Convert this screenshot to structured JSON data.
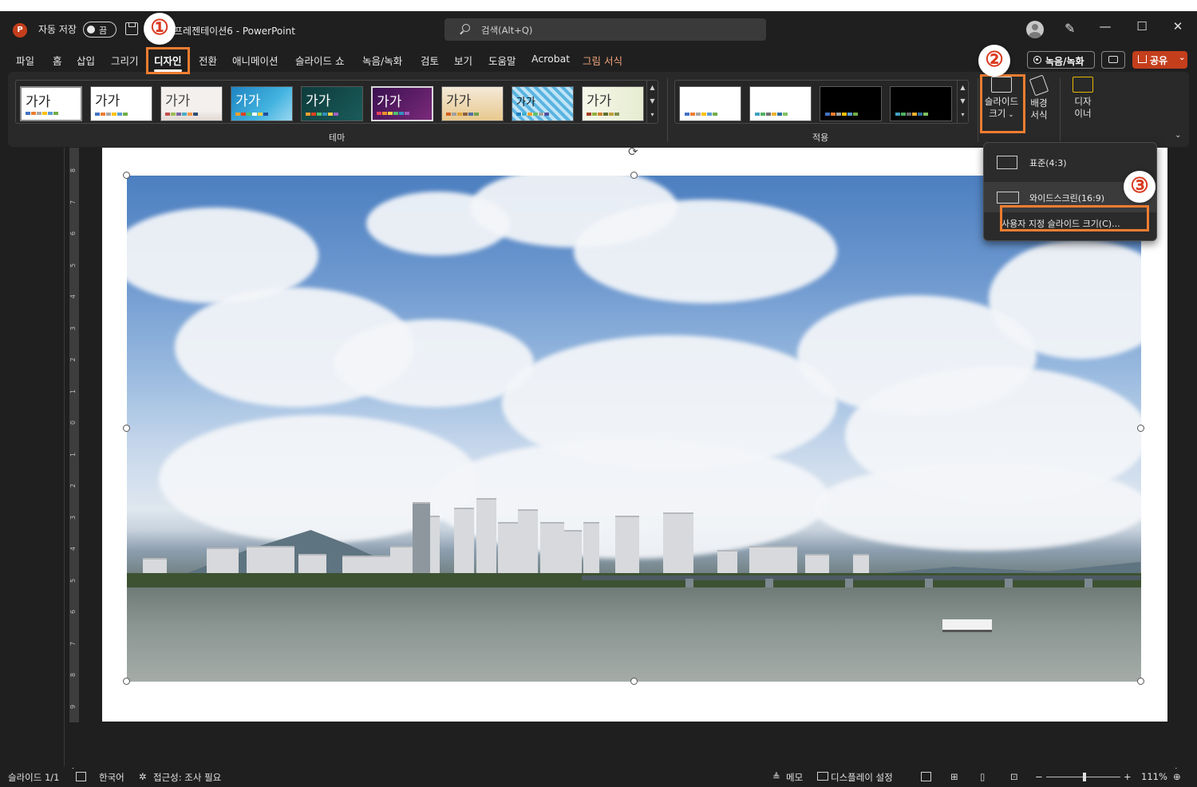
{
  "window": {
    "app_icon": "P",
    "autosave_label": "자동 저장",
    "autosave_state": "끔",
    "doc_title": "프레젠테이션6 - PowerPoint",
    "search_placeholder": "검색(Alt+Q)"
  },
  "tabs": [
    {
      "label": "파일"
    },
    {
      "label": "홈"
    },
    {
      "label": "삽입"
    },
    {
      "label": "그리기"
    },
    {
      "label": "디자인",
      "active": true
    },
    {
      "label": "전환"
    },
    {
      "label": "애니메이션"
    },
    {
      "label": "슬라이드 쇼"
    },
    {
      "label": "녹음/녹화"
    },
    {
      "label": "검토"
    },
    {
      "label": "보기"
    },
    {
      "label": "도움말"
    },
    {
      "label": "Acrobat"
    },
    {
      "label": "그림 서식",
      "contextual": true
    }
  ],
  "header_buttons": {
    "record": "녹음/녹화",
    "share": "공유"
  },
  "ribbon": {
    "themes_group_label": "테마",
    "variants_group_label": "적용",
    "theme_text": "가가",
    "slide_size": {
      "line1": "슬라이드",
      "line2": "크기"
    },
    "format_background": {
      "line1": "배경",
      "line2": "서식"
    },
    "designer": {
      "line1": "디자",
      "line2": "이너"
    }
  },
  "slide_size_menu": {
    "standard": "표준(4:3)",
    "widescreen": "와이드스크린(16:9)",
    "custom": "사용자 지정 슬라이드 크기(C)..."
  },
  "annotations": {
    "step1": "①",
    "step2": "②",
    "step3": "③",
    "color": "#ee7d31"
  },
  "ruler_numbers": [
    "8",
    "7",
    "6",
    "5",
    "4",
    "3",
    "2",
    "1",
    "0",
    "1",
    "2",
    "3",
    "4",
    "5",
    "6",
    "7",
    "8",
    "9"
  ],
  "status": {
    "slide_count": "슬라이드 1/1",
    "language": "한국어",
    "accessibility": "접근성: 조사 필요",
    "notes": "메모",
    "display_settings": "디스플레이 설정",
    "zoom_minus": "−",
    "zoom_plus": "+",
    "zoom_level": "111%"
  },
  "colors": {
    "accent_powerpoint": "#c43e1c",
    "window_bg": "#1f1f1f",
    "ribbon_bg": "#292929"
  }
}
